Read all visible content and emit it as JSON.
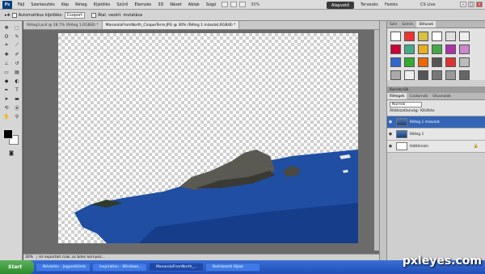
{
  "menu": {
    "logo": "Ps",
    "items": [
      "Fájl",
      "Szerkesztés",
      "Kép",
      "Réteg",
      "Kijelölés",
      "Szűrő",
      "Elemzés",
      "3D",
      "Nézet",
      "Ablak",
      "Súgó"
    ],
    "zoom": "30%"
  },
  "workspace": {
    "active": "Alapvető",
    "tervezés": "Tervezés",
    "festes": "Festés",
    "cslive": "CS Live"
  },
  "options": {
    "auto_select_label": "Automatikus kijelölés:",
    "auto_select_value": "Csoport",
    "transform_label": "Átal. vezérl. mutatása"
  },
  "tabs": [
    "Réteg3.psd @ 28,7% (Réteg 1,RGB/8) *",
    "ManarolaFromNorth_CinqueTerre.JPG @ 30% (Réteg 1 másolat,RGB/8) *"
  ],
  "status": {
    "zoom": "30%",
    "doc": "Az exportált csak 32 bites környez..."
  },
  "panels": {
    "styles_tabs": [
      "Szín",
      "Színm.",
      "Stílusok"
    ],
    "adjust_header": "Korrekciók",
    "layers_tabs": [
      "Rétegek",
      "Csatornák",
      "Útvonalak"
    ],
    "blend_mode": "Normál",
    "opacity_label": "Átlátszatlanság:",
    "fill_label": "Kitöltés:",
    "layers": [
      {
        "name": "Réteg 1 másolat",
        "selected": true
      },
      {
        "name": "Réteg 1",
        "selected": false
      },
      {
        "name": "Háttérszín",
        "selected": false
      }
    ]
  },
  "taskbar": {
    "start": "Start",
    "tasks": [
      "Névtelen - Jegyzettömb",
      "Inspiration - Windows...",
      "ManarolaFromNorth_...",
      "Beérkezett fájlok"
    ]
  },
  "watermark": "pxleyes.com",
  "colors": {
    "sea": "#1f4ea3",
    "rock": "#5b5a52",
    "selected_layer": "#3464b4"
  }
}
